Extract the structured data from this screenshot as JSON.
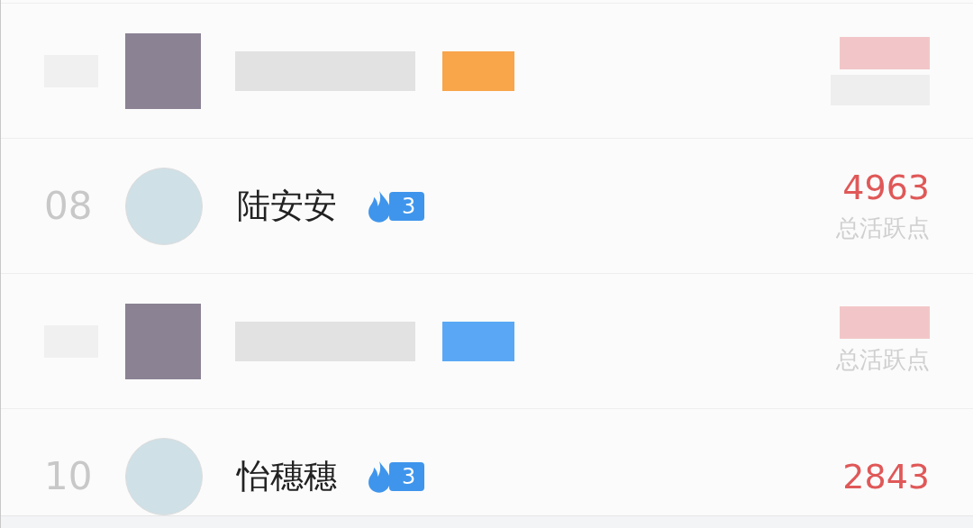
{
  "rows": [
    {
      "kind": "redacted",
      "color": "#f9a54a"
    },
    {
      "kind": "normal",
      "rank": "08",
      "name": "陆安安",
      "color": "#3f95ec",
      "badge_level": "3",
      "score": "4963",
      "score_label": "总活跃点"
    },
    {
      "kind": "redacted",
      "color": "#5aa8f5",
      "score_label": "总活跃点"
    },
    {
      "kind": "normal",
      "rank": "10",
      "name": "怡穗穗",
      "color": "#3f95ec",
      "badge_level": "3",
      "score": "2843"
    }
  ]
}
